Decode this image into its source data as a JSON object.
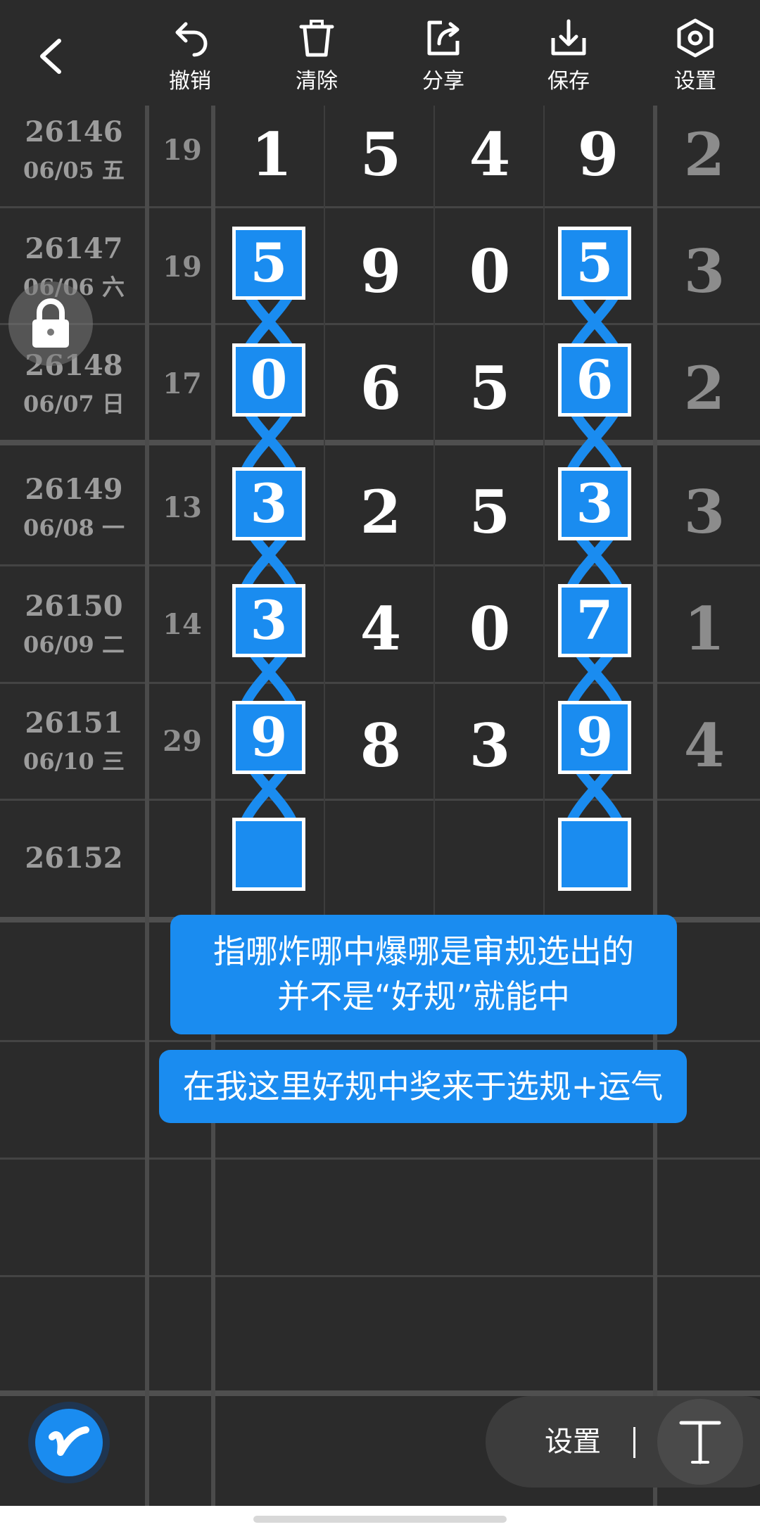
{
  "toolbar": {
    "back_icon": "chevron-left-icon",
    "items": [
      {
        "label": "撤销",
        "icon": "undo-icon"
      },
      {
        "label": "清除",
        "icon": "trash-icon"
      },
      {
        "label": "分享",
        "icon": "share-icon"
      },
      {
        "label": "保存",
        "icon": "download-icon"
      },
      {
        "label": "设置",
        "icon": "settings-icon"
      }
    ]
  },
  "rows": [
    {
      "issue": "26146",
      "date": "06/05 五",
      "sum": "19",
      "digits": [
        "1",
        "5",
        "4",
        "9"
      ],
      "span": "2"
    },
    {
      "issue": "26147",
      "date": "06/06 六",
      "sum": "19",
      "digits": [
        "5",
        "9",
        "0",
        "5"
      ],
      "span": "3"
    },
    {
      "issue": "26148",
      "date": "06/07 日",
      "sum": "17",
      "digits": [
        "0",
        "6",
        "5",
        "6"
      ],
      "span": "2"
    },
    {
      "issue": "26149",
      "date": "06/08 一",
      "sum": "13",
      "digits": [
        "3",
        "2",
        "5",
        "3"
      ],
      "span": "3"
    },
    {
      "issue": "26150",
      "date": "06/09 二",
      "sum": "14",
      "digits": [
        "3",
        "4",
        "0",
        "7"
      ],
      "span": "1"
    },
    {
      "issue": "26151",
      "date": "06/10 三",
      "sum": "29",
      "digits": [
        "9",
        "8",
        "3",
        "9"
      ],
      "span": "4"
    },
    {
      "issue": "26152",
      "date": "",
      "sum": "",
      "digits": [
        "",
        "",
        "",
        ""
      ],
      "span": ""
    }
  ],
  "highlight": {
    "columns": [
      0,
      3
    ],
    "from_row": 1,
    "to_row": 6,
    "color": "#1a8cf0"
  },
  "lock_icon": "lock-icon",
  "bubble1": {
    "line1": "指哪炸哪中爆哪是审规选出的",
    "line2": "并不是“好规”就能中"
  },
  "bubble2": {
    "text": "在我这里好规中奖来于选规+运气"
  },
  "bottom": {
    "fab_icon": "brush-logo-icon",
    "settings_label": "设置",
    "text_tool_icon": "text-tool-icon"
  },
  "colors": {
    "background": "#2b2b2b",
    "accent": "#1a8cf0",
    "grid": "#4b4b4b"
  }
}
